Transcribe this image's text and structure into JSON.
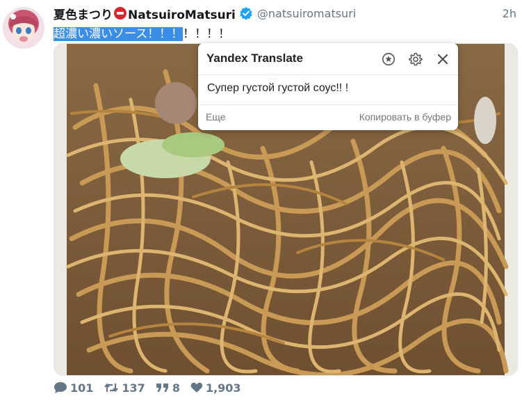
{
  "tweet": {
    "display_name_part1": "夏色まつり",
    "display_name_part2": "NatsuiroMatsuri",
    "handle": "@natsuiromatsuri",
    "time": "2h",
    "text_selected": "超濃い濃いソース！！！",
    "text_rest": "！！！！"
  },
  "translate_popup": {
    "title": "Yandex Translate",
    "translation": "Супер густой густой соус!!  !",
    "more_label": "Еще",
    "copy_label": "Копировать в буфер"
  },
  "actions": {
    "replies": "101",
    "retweets": "137",
    "quotes": "8",
    "likes": "1,903"
  },
  "colors": {
    "verified": "#1da1f2",
    "selection": "#3b8ee6",
    "secondary_text": "#657786"
  },
  "icons": [
    "avatar",
    "red-circle-emoji",
    "verified-badge-icon",
    "star-icon",
    "gear-icon",
    "close-icon",
    "reply-icon",
    "retweet-icon",
    "quote-icon",
    "heart-icon"
  ]
}
